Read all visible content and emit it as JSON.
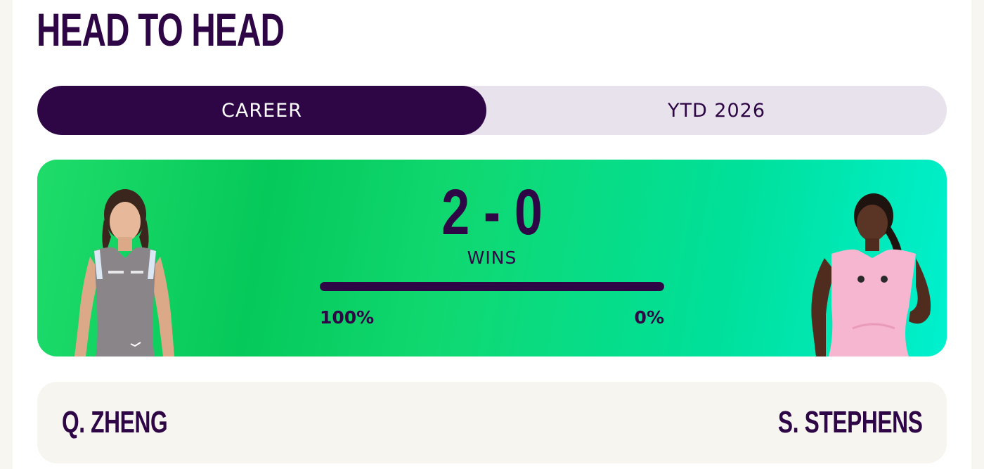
{
  "section": {
    "title": "HEAD TO HEAD"
  },
  "tabs": [
    {
      "label": "CAREER",
      "active": true
    },
    {
      "label": "YTD 2026",
      "active": false
    }
  ],
  "head_to_head": {
    "score": "2 - 0",
    "score_label": "WINS",
    "left_pct_text": "100%",
    "right_pct_text": "0%",
    "left_share": 1.0
  },
  "players": {
    "left": {
      "name": "Q. ZHENG"
    },
    "right": {
      "name": "S. STEPHENS"
    }
  },
  "colors": {
    "brand": "#2e0646",
    "accent_green": "#05c95a",
    "accent_teal": "#00f0cf",
    "tab_bg": "#e8e2ec"
  }
}
